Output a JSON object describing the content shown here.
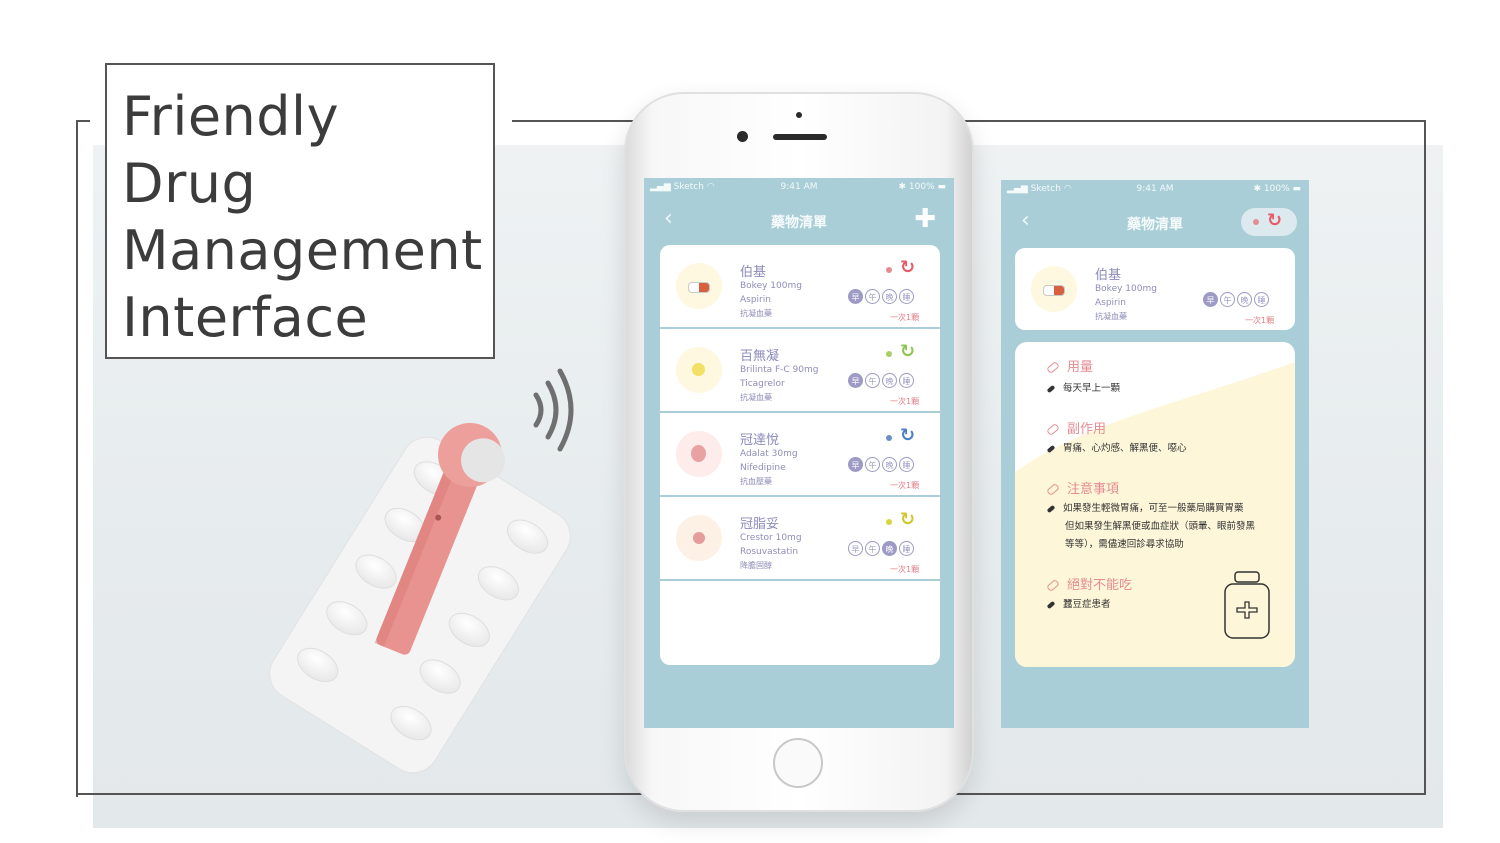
{
  "title_lines": [
    "Friendly",
    "Drug",
    "Management",
    "Interface"
  ],
  "colors": {
    "accent_purple": "#9d9bc5",
    "accent_pink": "#e48c92",
    "screen_bg": "#a9ced8",
    "device_pink": "#e8938f"
  },
  "status_bar": {
    "carrier": "Sketch",
    "time": "9:41 AM",
    "battery": "100%"
  },
  "list_screen": {
    "nav_title": "藥物清單",
    "back_icon": "‹",
    "add_icon": "✚",
    "drugs": [
      {
        "name": "伯基",
        "line1": "Bokey 100mg",
        "line2": "Aspirin",
        "line3": "抗凝血藥",
        "dose": "一次1顆",
        "dot_color": "#e48c92",
        "refresh_color": "#e85a66",
        "times": [
          "早",
          "午",
          "晚",
          "睡"
        ]
      },
      {
        "name": "百無凝",
        "line1": "Brilinta F-C 90mg",
        "line2": "Ticagrelor",
        "line3": "抗凝血藥",
        "dose": "一次1顆",
        "dot_color": "#a9cf63",
        "refresh_color": "#8fc552",
        "times": [
          "早",
          "午",
          "晚",
          "睡"
        ]
      },
      {
        "name": "冠達悅",
        "line1": "Adalat 30mg",
        "line2": "Nifedipine",
        "line3": "抗血壓藥",
        "dose": "一次1顆",
        "dot_color": "#6c8ec8",
        "refresh_color": "#4f7fc3",
        "times": [
          "早",
          "午",
          "晚",
          "睡"
        ]
      },
      {
        "name": "冠脂妥",
        "line1": "Crestor 10mg",
        "line2": "Rosuvastatin",
        "line3": "降膽固醇",
        "dose": "一次1顆",
        "dot_color": "#d8d43b",
        "refresh_color": "#d0c72a",
        "times": [
          "早",
          "午",
          "晚",
          "睡"
        ]
      }
    ]
  },
  "detail_screen": {
    "nav_title": "藥物清單",
    "back_icon": "‹",
    "drug": {
      "name": "伯基",
      "line1": "Bokey 100mg",
      "line2": "Aspirin",
      "line3": "抗凝血藥",
      "dose": "一次1顆",
      "times": [
        "早",
        "午",
        "晚",
        "睡"
      ]
    },
    "sections": [
      {
        "heading": "用量",
        "lines": [
          "每天早上一顆"
        ]
      },
      {
        "heading": "副作用",
        "lines": [
          "胃痛、心灼感、解黑便、噁心"
        ]
      },
      {
        "heading": "注意事項",
        "lines": [
          "如果發生輕微胃痛，可至一般藥局購買胃藥",
          "但如果發生解黑便或血症狀（頭暈、眼前發黑",
          "等等），需儘速回診尋求協助"
        ]
      },
      {
        "heading": "絕對不能吃",
        "lines": [
          "蠶豆症患者"
        ]
      }
    ]
  }
}
